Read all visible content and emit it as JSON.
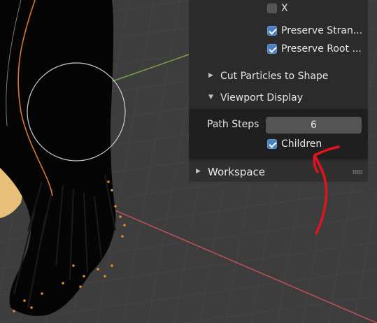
{
  "particle_settings": {
    "x_label": "X",
    "x_checked": false,
    "preserve_strand_label": "Preserve Stran...",
    "preserve_strand_checked": true,
    "preserve_root_label": "Preserve Root ...",
    "preserve_root_checked": true
  },
  "panels": {
    "cut_particles_label": "Cut Particles to Shape",
    "viewport_display_label": "Viewport Display"
  },
  "viewport_display": {
    "path_steps_label": "Path Steps",
    "path_steps_value": "6",
    "children_label": "Children",
    "children_checked": true
  },
  "workspace": {
    "label": "Workspace"
  },
  "colors": {
    "panel_bg": "#2b2b2b",
    "subpanel_bg": "#1f1f1f",
    "checkbox_on": "#4a7fc0",
    "annotation": "#e0141c",
    "viewport_bg": "#3d3d3d",
    "hair_highlight": "#e08a2a"
  }
}
